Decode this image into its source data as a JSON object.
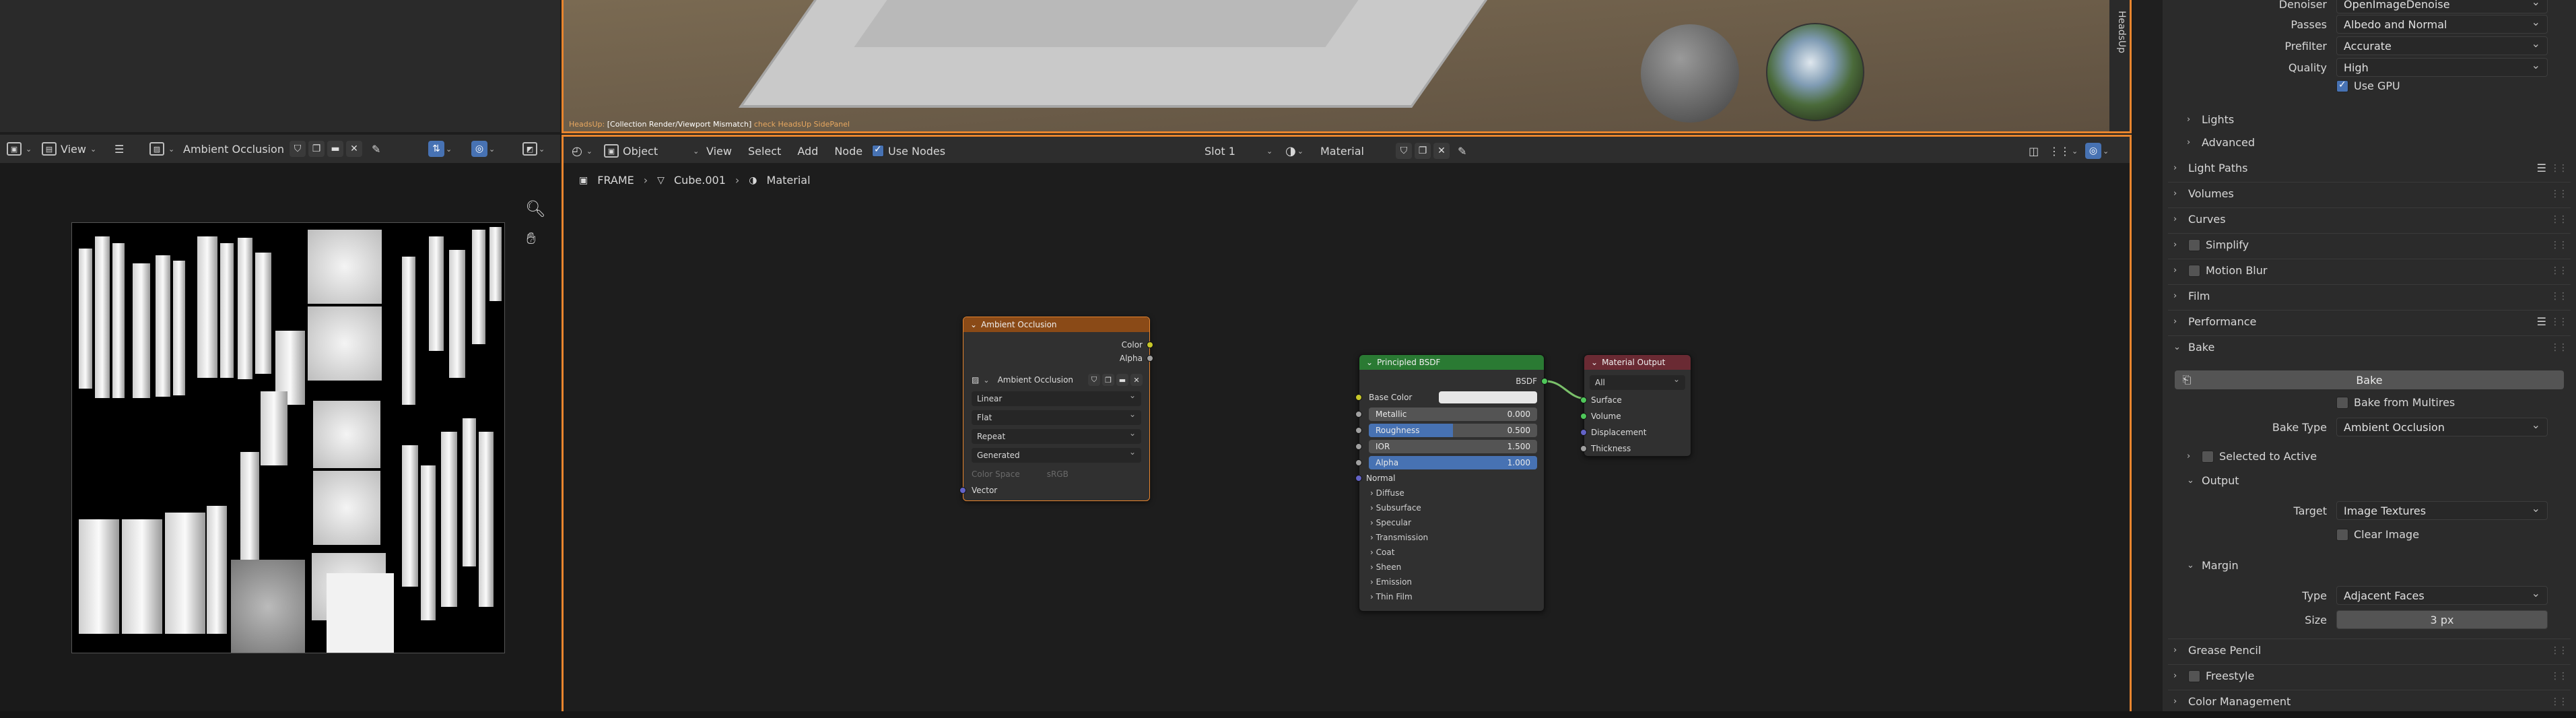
{
  "viewport": {
    "hint": "Collection Render/Viewport Mismatch",
    "hint_prefix": "HeadsUp",
    "hint_suffix": "check HeadsUp SidePanel",
    "side_tab": "HeadsUp"
  },
  "image_editor": {
    "view_menu": "View",
    "image_name": "Ambient Occlusion"
  },
  "node_editor": {
    "mode": "Object",
    "menus": [
      "View",
      "Select",
      "Add",
      "Node"
    ],
    "use_nodes_label": "Use Nodes",
    "slot": "Slot 1",
    "material": "Material",
    "breadcrumb": {
      "frame": "FRAME",
      "object": "Cube.001",
      "material": "Material"
    },
    "ao_node": {
      "title": "Ambient Occlusion",
      "out_color": "Color",
      "out_alpha": "Alpha",
      "image_name": "Ambient Occlusion",
      "interpolation": "Linear",
      "projection": "Flat",
      "extension": "Repeat",
      "source": "Generated",
      "color_space_label": "Color Space",
      "color_space_value": "sRGB",
      "in_vector": "Vector"
    },
    "bsdf_node": {
      "title": "Principled BSDF",
      "out_bsdf": "BSDF",
      "base_color": "Base Color",
      "metallic_label": "Metallic",
      "metallic_value": "0.000",
      "roughness_label": "Roughness",
      "roughness_value": "0.500",
      "roughness_fraction": 0.5,
      "ior_label": "IOR",
      "ior_value": "1.500",
      "alpha_label": "Alpha",
      "alpha_value": "1.000",
      "alpha_fraction": 1.0,
      "normal": "Normal",
      "subpanels": [
        "Diffuse",
        "Subsurface",
        "Specular",
        "Transmission",
        "Coat",
        "Sheen",
        "Emission",
        "Thin Film"
      ]
    },
    "output_node": {
      "title": "Material Output",
      "target": "All",
      "surface": "Surface",
      "volume": "Volume",
      "displacement": "Displacement",
      "thickness": "Thickness"
    }
  },
  "properties": {
    "denoiser_label": "Denoiser",
    "denoiser_value": "OpenImageDenoise",
    "passes_label": "Passes",
    "passes_value": "Albedo and Normal",
    "prefilter_label": "Prefilter",
    "prefilter_value": "Accurate",
    "quality_label": "Quality",
    "quality_value": "High",
    "use_gpu": "Use GPU",
    "lights": "Lights",
    "advanced": "Advanced",
    "light_paths": "Light Paths",
    "volumes": "Volumes",
    "curves": "Curves",
    "simplify": "Simplify",
    "motion_blur": "Motion Blur",
    "film": "Film",
    "performance": "Performance",
    "bake": "Bake",
    "bake_button": "Bake",
    "bake_from_multires": "Bake from Multires",
    "bake_type_label": "Bake Type",
    "bake_type_value": "Ambient Occlusion",
    "selected_to_active": "Selected to Active",
    "output": "Output",
    "target_label": "Target",
    "target_value": "Image Textures",
    "clear_image": "Clear Image",
    "margin": "Margin",
    "type_label": "Type",
    "type_value": "Adjacent Faces",
    "size_label": "Size",
    "size_value": "3 px",
    "grease_pencil": "Grease Pencil",
    "freestyle": "Freestyle",
    "color_management": "Color Management"
  },
  "colors": {
    "accent_orange": "#e8852e",
    "blue": "#4772b3",
    "ao_header": "#8a4a17",
    "bsdf_header": "#2a7a33",
    "output_header": "#6a2a33"
  }
}
